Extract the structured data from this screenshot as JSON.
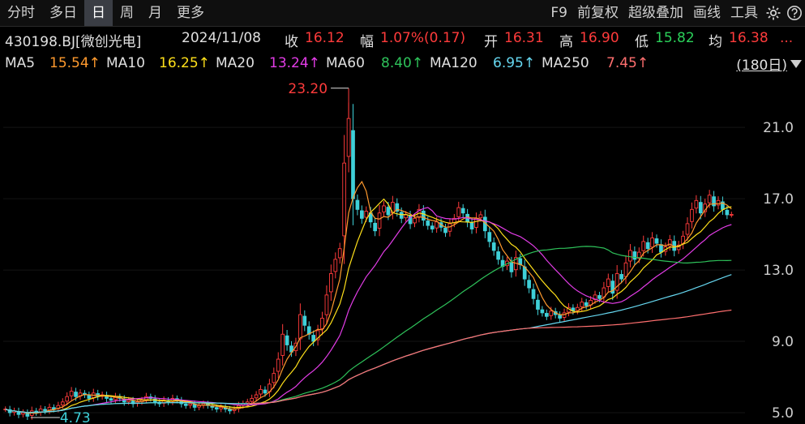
{
  "toolbar": {
    "tabs": [
      {
        "label": "分时"
      },
      {
        "label": "多日"
      },
      {
        "label": "日",
        "active": true
      },
      {
        "label": "周"
      },
      {
        "label": "月"
      },
      {
        "label": "更多"
      }
    ],
    "tools": [
      "F9",
      "前复权",
      "超级叠加",
      "画线",
      "工具"
    ],
    "icons": [
      "gear-icon",
      "help-icon"
    ]
  },
  "quote": {
    "code_name": "430198.BJ[微创光电]",
    "date": "2024/11/08",
    "close_label": "收",
    "close": "16.12",
    "change_label": "幅",
    "change": "1.07%(0.17)",
    "open_label": "开",
    "open": "16.31",
    "high_label": "高",
    "high": "16.90",
    "low_label": "低",
    "low": "15.82",
    "avg_label": "均",
    "avg": "16.38",
    "more": "..."
  },
  "ma": {
    "items": [
      {
        "label": "MA5",
        "value": "15.54↑",
        "color": "#ff9a2e"
      },
      {
        "label": "MA10",
        "value": "16.25↑",
        "color": "#ffe01a"
      },
      {
        "label": "MA20",
        "value": "13.24↑",
        "color": "#e23ce6"
      },
      {
        "label": "MA60",
        "value": "8.40↑",
        "color": "#2ec25a"
      },
      {
        "label": "MA120",
        "value": "6.95↑",
        "color": "#66d7f0"
      },
      {
        "label": "MA250",
        "value": "7.45↑",
        "color": "#ff6f6f"
      }
    ],
    "range_label": "(180日)"
  },
  "chart_data": {
    "type": "candlestick",
    "y_ticks": [
      "21.0",
      "17.0",
      "13.0",
      "9.0",
      "5.0"
    ],
    "y_tick_values": [
      21,
      17,
      13,
      9,
      5
    ],
    "ylim": [
      4.5,
      23.6
    ],
    "max_label": "23.20",
    "min_label": "4.73",
    "up_color": "#ff3b3b",
    "down_color": "#3fd0d8",
    "closes": [
      5.2,
      5.0,
      5.1,
      4.9,
      5.0,
      4.8,
      5.1,
      5.0,
      5.2,
      5.1,
      5.3,
      5.2,
      5.4,
      5.6,
      5.9,
      6.2,
      5.9,
      6.1,
      6.0,
      5.8,
      6.1,
      5.9,
      6.0,
      5.8,
      5.7,
      5.9,
      5.8,
      5.6,
      5.7,
      5.5,
      5.6,
      5.7,
      5.9,
      5.8,
      5.6,
      5.5,
      5.7,
      5.6,
      5.8,
      5.7,
      5.5,
      5.4,
      5.5,
      5.3,
      5.4,
      5.5,
      5.4,
      5.3,
      5.2,
      5.3,
      5.2,
      5.1,
      5.2,
      5.4,
      5.5,
      5.6,
      5.8,
      6.0,
      6.3,
      6.1,
      6.6,
      7.2,
      8.0,
      9.4,
      8.8,
      8.4,
      8.9,
      10.5,
      9.9,
      9.4,
      9.0,
      9.6,
      10.3,
      11.6,
      12.8,
      13.6,
      14.2,
      19.0,
      21.5,
      17.0,
      16.4,
      15.9,
      16.3,
      15.7,
      15.2,
      16.2,
      16.6,
      16.1,
      16.8,
      16.3,
      15.9,
      16.1,
      15.6,
      15.9,
      16.4,
      15.8,
      15.5,
      15.3,
      15.7,
      15.4,
      15.1,
      15.6,
      15.9,
      16.5,
      16.2,
      15.7,
      15.3,
      15.9,
      16.1,
      15.2,
      14.6,
      14.1,
      13.6,
      13.2,
      13.5,
      12.9,
      13.7,
      13.3,
      12.5,
      12.0,
      11.4,
      10.8,
      10.6,
      10.4,
      10.7,
      10.5,
      10.3,
      10.6,
      10.9,
      10.7,
      10.9,
      11.2,
      11.0,
      11.3,
      11.6,
      11.4,
      12.0,
      12.5,
      11.7,
      12.8,
      12.5,
      13.4,
      14.1,
      13.6,
      14.0,
      14.6,
      14.2,
      14.8,
      14.5,
      14.0,
      14.3,
      14.7,
      14.1,
      14.4,
      14.9,
      15.6,
      16.4,
      16.9,
      16.2,
      16.7,
      17.2,
      16.6,
      16.9,
      16.4,
      16.1,
      16.12
    ],
    "ma_series": [
      {
        "label": "MA5",
        "color": "#ff9a2e"
      },
      {
        "label": "MA10",
        "color": "#ffe01a"
      },
      {
        "label": "MA20",
        "color": "#e23ce6"
      },
      {
        "label": "MA60",
        "color": "#2ec25a"
      },
      {
        "label": "MA120",
        "color": "#66d7f0"
      },
      {
        "label": "MA250",
        "color": "#ff6f6f"
      }
    ]
  }
}
